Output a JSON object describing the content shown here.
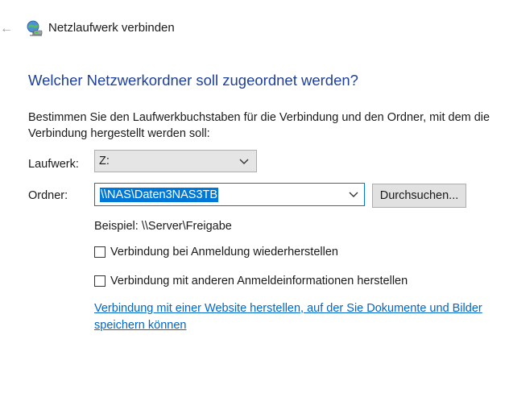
{
  "window": {
    "title": "Netzlaufwerk verbinden",
    "back_icon": "back-arrow-icon",
    "app_icon": "network-drive-icon"
  },
  "main_instruction": "Welcher Netzwerkordner soll zugeordnet werden?",
  "description": "Bestimmen Sie den Laufwerkbuchstaben für die Verbindung und den Ordner, mit dem die Verbindung hergestellt werden soll:",
  "drive": {
    "label": "Laufwerk:",
    "value": "Z:"
  },
  "folder": {
    "label": "Ordner:",
    "value": "\\\\NAS\\Daten3NAS3TB"
  },
  "browse_label": "Durchsuchen...",
  "example": "Beispiel: \\\\Server\\Freigabe",
  "checkboxes": {
    "reconnect": {
      "label": "Verbindung bei Anmeldung wiederherstellen",
      "checked": false
    },
    "credentials": {
      "label": "Verbindung mit anderen Anmeldeinformationen herstellen",
      "checked": false
    }
  },
  "link": "Verbindung mit einer Website herstellen, auf der Sie Dokumente und Bilder speichern können",
  "colors": {
    "heading": "#1e3f9a",
    "accent": "#0078d7",
    "link": "#0066cc"
  }
}
